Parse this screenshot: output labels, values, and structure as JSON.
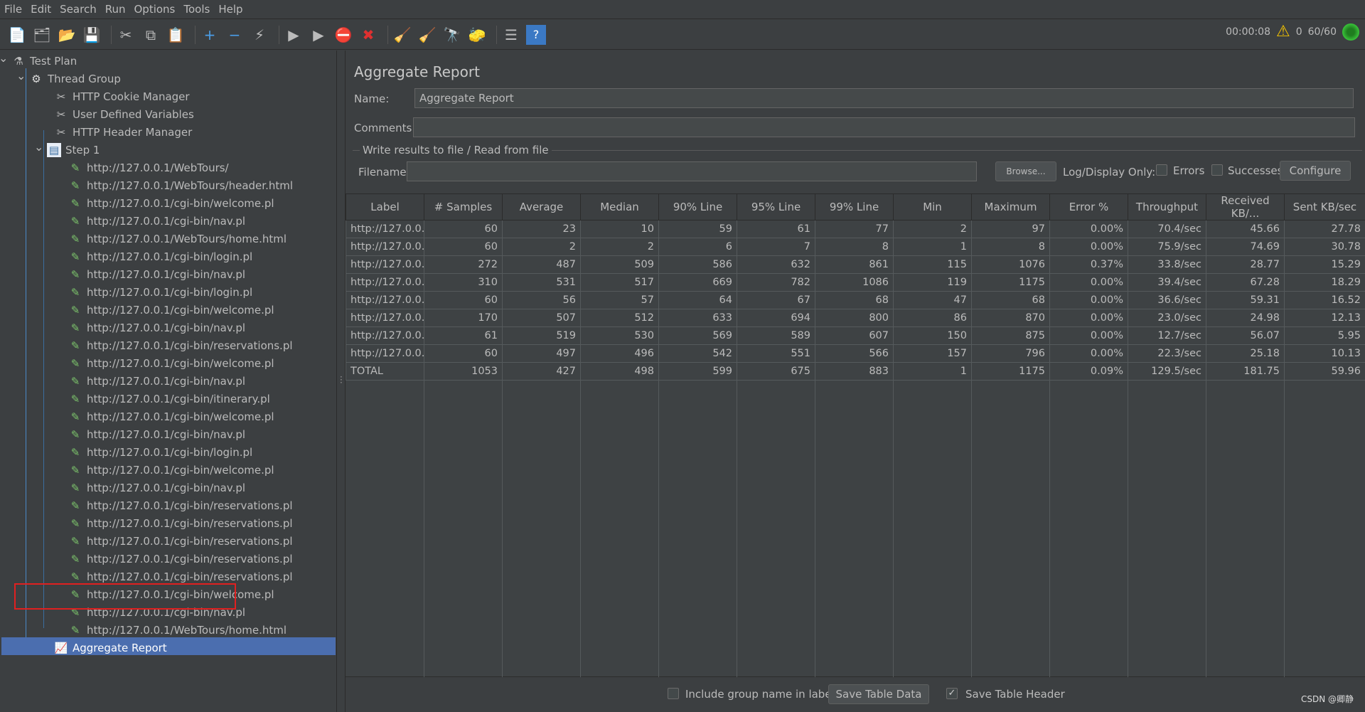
{
  "menu": [
    "File",
    "Edit",
    "Search",
    "Run",
    "Options",
    "Tools",
    "Help"
  ],
  "toolbar": {
    "icons": [
      "new-icon",
      "templates-icon",
      "open-icon",
      "save-icon",
      "cut-icon",
      "copy-icon",
      "paste-icon",
      "expand-icon",
      "collapse-icon",
      "toggle-icon",
      "start-icon",
      "start-no-pauses-icon",
      "stop-icon",
      "shutdown-icon",
      "clear-icon",
      "clear-all-icon",
      "search-icon",
      "reset-search-icon",
      "function-helper-icon",
      "help-icon"
    ]
  },
  "status": {
    "timer": "00:00:08",
    "warnings": "0",
    "threads": "60/60"
  },
  "tree": {
    "items": [
      {
        "label": "Test Plan",
        "level": 0,
        "icon": "test-plan-icon",
        "expanded": true
      },
      {
        "label": "Thread Group",
        "level": 1,
        "icon": "gear-icon",
        "expanded": true
      },
      {
        "label": "HTTP Cookie Manager",
        "level": 2,
        "icon": "config-icon"
      },
      {
        "label": "User Defined Variables",
        "level": 2,
        "icon": "config-icon"
      },
      {
        "label": "HTTP Header Manager",
        "level": 2,
        "icon": "config-icon"
      },
      {
        "label": "Step 1",
        "level": 2,
        "icon": "transaction-icon",
        "expanded": true
      },
      {
        "label": "http://127.0.0.1/WebTours/",
        "level": 3,
        "icon": "sampler-icon"
      },
      {
        "label": "http://127.0.0.1/WebTours/header.html",
        "level": 3,
        "icon": "sampler-icon"
      },
      {
        "label": "http://127.0.0.1/cgi-bin/welcome.pl",
        "level": 3,
        "icon": "sampler-icon"
      },
      {
        "label": "http://127.0.0.1/cgi-bin/nav.pl",
        "level": 3,
        "icon": "sampler-icon"
      },
      {
        "label": "http://127.0.0.1/WebTours/home.html",
        "level": 3,
        "icon": "sampler-icon"
      },
      {
        "label": "http://127.0.0.1/cgi-bin/login.pl",
        "level": 3,
        "icon": "sampler-icon"
      },
      {
        "label": "http://127.0.0.1/cgi-bin/nav.pl",
        "level": 3,
        "icon": "sampler-icon"
      },
      {
        "label": "http://127.0.0.1/cgi-bin/login.pl",
        "level": 3,
        "icon": "sampler-icon"
      },
      {
        "label": "http://127.0.0.1/cgi-bin/welcome.pl",
        "level": 3,
        "icon": "sampler-icon"
      },
      {
        "label": "http://127.0.0.1/cgi-bin/nav.pl",
        "level": 3,
        "icon": "sampler-icon"
      },
      {
        "label": "http://127.0.0.1/cgi-bin/reservations.pl",
        "level": 3,
        "icon": "sampler-icon"
      },
      {
        "label": "http://127.0.0.1/cgi-bin/welcome.pl",
        "level": 3,
        "icon": "sampler-icon"
      },
      {
        "label": "http://127.0.0.1/cgi-bin/nav.pl",
        "level": 3,
        "icon": "sampler-icon"
      },
      {
        "label": "http://127.0.0.1/cgi-bin/itinerary.pl",
        "level": 3,
        "icon": "sampler-icon"
      },
      {
        "label": "http://127.0.0.1/cgi-bin/welcome.pl",
        "level": 3,
        "icon": "sampler-icon"
      },
      {
        "label": "http://127.0.0.1/cgi-bin/nav.pl",
        "level": 3,
        "icon": "sampler-icon"
      },
      {
        "label": "http://127.0.0.1/cgi-bin/login.pl",
        "level": 3,
        "icon": "sampler-icon"
      },
      {
        "label": "http://127.0.0.1/cgi-bin/welcome.pl",
        "level": 3,
        "icon": "sampler-icon"
      },
      {
        "label": "http://127.0.0.1/cgi-bin/nav.pl",
        "level": 3,
        "icon": "sampler-icon"
      },
      {
        "label": "http://127.0.0.1/cgi-bin/reservations.pl",
        "level": 3,
        "icon": "sampler-icon"
      },
      {
        "label": "http://127.0.0.1/cgi-bin/reservations.pl",
        "level": 3,
        "icon": "sampler-icon"
      },
      {
        "label": "http://127.0.0.1/cgi-bin/reservations.pl",
        "level": 3,
        "icon": "sampler-icon"
      },
      {
        "label": "http://127.0.0.1/cgi-bin/reservations.pl",
        "level": 3,
        "icon": "sampler-icon"
      },
      {
        "label": "http://127.0.0.1/cgi-bin/reservations.pl",
        "level": 3,
        "icon": "sampler-icon"
      },
      {
        "label": "http://127.0.0.1/cgi-bin/welcome.pl",
        "level": 3,
        "icon": "sampler-icon"
      },
      {
        "label": "http://127.0.0.1/cgi-bin/nav.pl",
        "level": 3,
        "icon": "sampler-icon"
      },
      {
        "label": "http://127.0.0.1/WebTours/home.html",
        "level": 3,
        "icon": "sampler-icon"
      },
      {
        "label": "Aggregate Report",
        "level": 2,
        "icon": "report-icon",
        "selected": true
      }
    ]
  },
  "panel": {
    "title": "Aggregate Report",
    "name_label": "Name:",
    "name_value": "Aggregate Report",
    "comments_label": "Comments:",
    "comments_value": "",
    "file_group": "Write results to file / Read from file",
    "filename_label": "Filename",
    "filename_value": "",
    "browse": "Browse...",
    "log_only": "Log/Display Only:",
    "errors": "Errors",
    "errors_checked": false,
    "successes": "Successes",
    "successes_checked": false,
    "configure": "Configure"
  },
  "table": {
    "columns": [
      "Label",
      "# Samples",
      "Average",
      "Median",
      "90% Line",
      "95% Line",
      "99% Line",
      "Min",
      "Maximum",
      "Error %",
      "Throughput",
      "Received KB/...",
      "Sent KB/sec"
    ],
    "rows": [
      [
        "http://127.0.0....",
        "60",
        "23",
        "10",
        "59",
        "61",
        "77",
        "2",
        "97",
        "0.00%",
        "70.4/sec",
        "45.66",
        "27.78"
      ],
      [
        "http://127.0.0....",
        "60",
        "2",
        "2",
        "6",
        "7",
        "8",
        "1",
        "8",
        "0.00%",
        "75.9/sec",
        "74.69",
        "30.78"
      ],
      [
        "http://127.0.0....",
        "272",
        "487",
        "509",
        "586",
        "632",
        "861",
        "115",
        "1076",
        "0.37%",
        "33.8/sec",
        "28.77",
        "15.29"
      ],
      [
        "http://127.0.0....",
        "310",
        "531",
        "517",
        "669",
        "782",
        "1086",
        "119",
        "1175",
        "0.00%",
        "39.4/sec",
        "67.28",
        "18.29"
      ],
      [
        "http://127.0.0....",
        "60",
        "56",
        "57",
        "64",
        "67",
        "68",
        "47",
        "68",
        "0.00%",
        "36.6/sec",
        "59.31",
        "16.52"
      ],
      [
        "http://127.0.0....",
        "170",
        "507",
        "512",
        "633",
        "694",
        "800",
        "86",
        "870",
        "0.00%",
        "23.0/sec",
        "24.98",
        "12.13"
      ],
      [
        "http://127.0.0....",
        "61",
        "519",
        "530",
        "569",
        "589",
        "607",
        "150",
        "875",
        "0.00%",
        "12.7/sec",
        "56.07",
        "5.95"
      ],
      [
        "http://127.0.0....",
        "60",
        "497",
        "496",
        "542",
        "551",
        "566",
        "157",
        "796",
        "0.00%",
        "22.3/sec",
        "25.18",
        "10.13"
      ],
      [
        "TOTAL",
        "1053",
        "427",
        "498",
        "599",
        "675",
        "883",
        "1",
        "1175",
        "0.09%",
        "129.5/sec",
        "181.75",
        "59.96"
      ]
    ]
  },
  "footer": {
    "include_group": "Include group name in label?",
    "include_group_checked": false,
    "save_data": "Save Table Data",
    "save_header": "Save Table Header",
    "save_header_checked": true
  },
  "watermark": "CSDN @卿静",
  "colors": {
    "background": "#3c3f41",
    "selection": "#4b6eaf",
    "highlight_box": "#e02020"
  }
}
